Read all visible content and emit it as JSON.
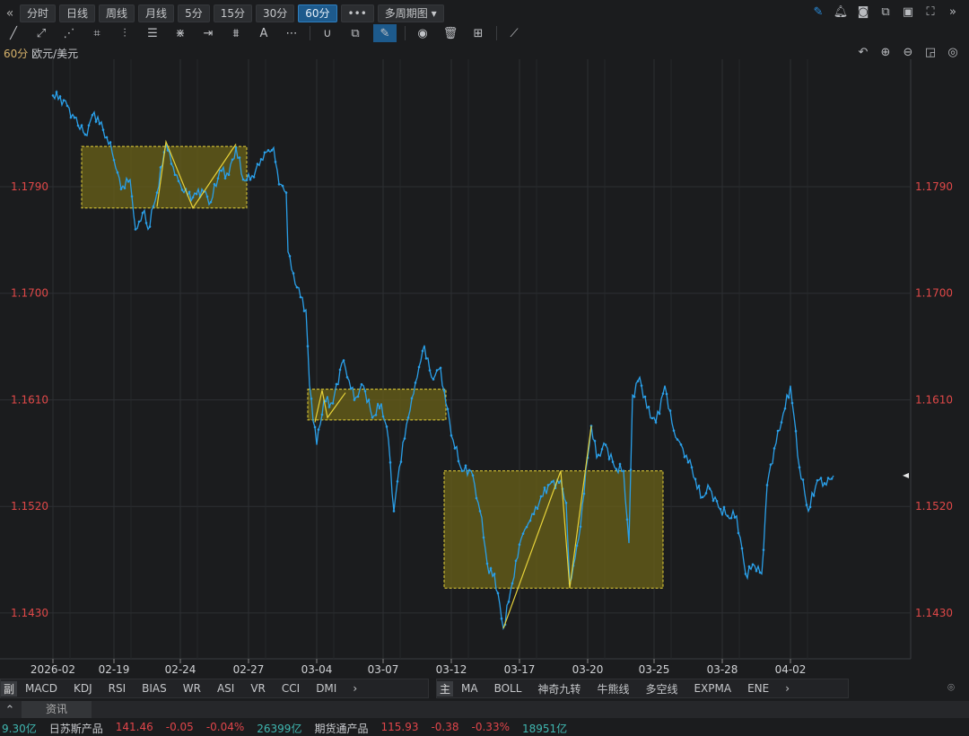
{
  "toolbar": {
    "periods": [
      "分时",
      "日线",
      "周线",
      "月线",
      "5分",
      "15分",
      "30分",
      "60分"
    ],
    "active_period": "60分",
    "more": "•••",
    "multi": "多周期图 ▾"
  },
  "drawing_tools": [
    "line",
    "segment",
    "polyline",
    "rect",
    "channel",
    "fib",
    "fan",
    "measure",
    "parallel",
    "text",
    "more",
    "magnet",
    "layers",
    "pen",
    "eye",
    "trash",
    "grid",
    "ruler"
  ],
  "header": {
    "period": "60分",
    "symbol": "欧元/美元"
  },
  "colors": {
    "price_line": "#2a9fe8",
    "box_fill": "#6b6218",
    "box_border": "#e6d23a",
    "zigzag": "#e6d23a",
    "axis_label": "#e04848",
    "bg": "#1b1c1e"
  },
  "chart_data": {
    "type": "line",
    "y_ticks": [
      "1.1790",
      "1.1700",
      "1.1610",
      "1.1520",
      "1.1430"
    ],
    "ylim": [
      1.14,
      1.189
    ],
    "x_ticks": [
      {
        "label": "2026-02",
        "i": 0
      },
      {
        "label": "02-19",
        "i": 34
      },
      {
        "label": "02-24",
        "i": 71
      },
      {
        "label": "02-27",
        "i": 109
      },
      {
        "label": "03-04",
        "i": 147
      },
      {
        "label": "03-07",
        "i": 184
      },
      {
        "label": "03-12",
        "i": 222
      },
      {
        "label": "03-17",
        "i": 260
      },
      {
        "label": "03-20",
        "i": 298
      },
      {
        "label": "03-25",
        "i": 335
      },
      {
        "label": "03-28",
        "i": 373
      },
      {
        "label": "04-02",
        "i": 411
      }
    ],
    "series": [
      [
        0,
        1.1867
      ],
      [
        6,
        1.1863
      ],
      [
        11,
        1.1851
      ],
      [
        18,
        1.1834
      ],
      [
        23,
        1.1853
      ],
      [
        28,
        1.1838
      ],
      [
        33,
        1.1819
      ],
      [
        38,
        1.1788
      ],
      [
        43,
        1.1796
      ],
      [
        46,
        1.1754
      ],
      [
        51,
        1.177
      ],
      [
        53,
        1.1754
      ],
      [
        58,
        1.1785
      ],
      [
        63,
        1.1826
      ],
      [
        68,
        1.18
      ],
      [
        73,
        1.1785
      ],
      [
        78,
        1.1781
      ],
      [
        83,
        1.1788
      ],
      [
        88,
        1.1777
      ],
      [
        93,
        1.1804
      ],
      [
        98,
        1.18
      ],
      [
        102,
        1.1823
      ],
      [
        106,
        1.1796
      ],
      [
        110,
        1.1796
      ],
      [
        113,
        1.1804
      ],
      [
        118,
        1.1819
      ],
      [
        123,
        1.1823
      ],
      [
        126,
        1.1792
      ],
      [
        130,
        1.1785
      ],
      [
        131,
        1.1735
      ],
      [
        133,
        1.172
      ],
      [
        136,
        1.1705
      ],
      [
        141,
        1.1686
      ],
      [
        143,
        1.1622
      ],
      [
        147,
        1.1572
      ],
      [
        151,
        1.161
      ],
      [
        156,
        1.1607
      ],
      [
        161,
        1.1641
      ],
      [
        163,
        1.1637
      ],
      [
        168,
        1.161
      ],
      [
        173,
        1.1622
      ],
      [
        178,
        1.1595
      ],
      [
        183,
        1.1607
      ],
      [
        187,
        1.1576
      ],
      [
        190,
        1.1516
      ],
      [
        193,
        1.1553
      ],
      [
        198,
        1.1595
      ],
      [
        203,
        1.1629
      ],
      [
        207,
        1.1656
      ],
      [
        211,
        1.1629
      ],
      [
        216,
        1.1637
      ],
      [
        219,
        1.1607
      ],
      [
        223,
        1.1576
      ],
      [
        228,
        1.155
      ],
      [
        233,
        1.155
      ],
      [
        238,
        1.1516
      ],
      [
        243,
        1.1463
      ],
      [
        246,
        1.1463
      ],
      [
        251,
        1.1417
      ],
      [
        256,
        1.1455
      ],
      [
        261,
        1.1493
      ],
      [
        266,
        1.1508
      ],
      [
        271,
        1.1523
      ],
      [
        276,
        1.1538
      ],
      [
        283,
        1.1542
      ],
      [
        286,
        1.1523
      ],
      [
        288,
        1.1455
      ],
      [
        293,
        1.1493
      ],
      [
        300,
        1.1588
      ],
      [
        303,
        1.1561
      ],
      [
        308,
        1.1572
      ],
      [
        313,
        1.1553
      ],
      [
        318,
        1.155
      ],
      [
        321,
        1.1489
      ],
      [
        323,
        1.1614
      ],
      [
        327,
        1.1629
      ],
      [
        331,
        1.1603
      ],
      [
        336,
        1.1591
      ],
      [
        341,
        1.1622
      ],
      [
        346,
        1.1584
      ],
      [
        351,
        1.1569
      ],
      [
        356,
        1.1553
      ],
      [
        361,
        1.1527
      ],
      [
        366,
        1.1535
      ],
      [
        371,
        1.1519
      ],
      [
        376,
        1.1512
      ],
      [
        381,
        1.1512
      ],
      [
        386,
        1.1463
      ],
      [
        391,
        1.147
      ],
      [
        395,
        1.1463
      ],
      [
        398,
        1.1538
      ],
      [
        402,
        1.1569
      ],
      [
        406,
        1.1591
      ],
      [
        411,
        1.1622
      ],
      [
        416,
        1.1553
      ],
      [
        421,
        1.1516
      ],
      [
        426,
        1.1542
      ],
      [
        431,
        1.1538
      ],
      [
        435,
        1.1546
      ]
    ],
    "boxes": [
      {
        "i": [
          16,
          108
        ],
        "price": [
          1.1772,
          1.1824
        ]
      },
      {
        "i": [
          142,
          219
        ],
        "price": [
          1.1593,
          1.1619
        ]
      },
      {
        "i": [
          218,
          340
        ],
        "price": [
          1.1451,
          1.155
        ]
      }
    ],
    "zigzags": [
      [
        [
          58,
          1.1773
        ],
        [
          63,
          1.1828
        ],
        [
          78,
          1.1772
        ],
        [
          102,
          1.1826
        ]
      ],
      [
        [
          146,
          1.1591
        ],
        [
          150,
          1.1618
        ],
        [
          153,
          1.1595
        ],
        [
          163,
          1.1616
        ]
      ],
      [
        [
          251,
          1.1417
        ],
        [
          283,
          1.155
        ],
        [
          288,
          1.1451
        ],
        [
          300,
          1.1588
        ]
      ]
    ],
    "last_price": 1.1546
  },
  "sub_indicators": {
    "lead": "副",
    "items": [
      "MACD",
      "KDJ",
      "RSI",
      "BIAS",
      "WR",
      "ASI",
      "VR",
      "CCI",
      "DMI"
    ],
    "more": "›"
  },
  "main_indicators": {
    "lead": "主",
    "items": [
      "MA",
      "BOLL",
      "神奇九转",
      "牛熊线",
      "多空线",
      "EXPMA",
      "ENE"
    ],
    "more": "›"
  },
  "info_tab": "资讯",
  "ticker": [
    "9.30亿",
    "日苏斯产品",
    "141.46",
    "-0.05",
    "-0.04%",
    "26399亿",
    "期货通产品",
    "115.93",
    "-0.38",
    "-0.33%",
    "18951亿"
  ]
}
